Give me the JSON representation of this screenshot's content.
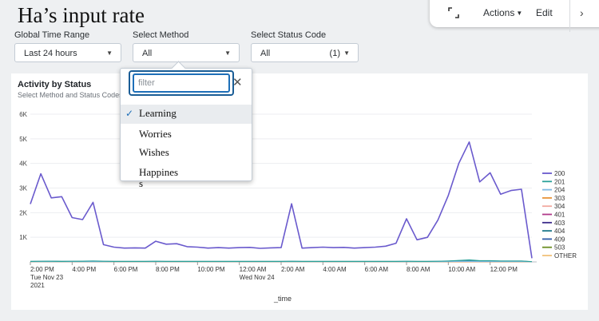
{
  "page": {
    "title": "Ha’s input rate"
  },
  "toolbar": {
    "actions_label": "Actions",
    "edit_label": "Edit"
  },
  "filters": {
    "time_range": {
      "label": "Global Time Range",
      "value": "Last 24 hours"
    },
    "method": {
      "label": "Select Method",
      "value": "All"
    },
    "status_code": {
      "label": "Select Status Code",
      "value": "All",
      "count": "(1)"
    }
  },
  "method_popover": {
    "filter_placeholder": "filter",
    "options": [
      {
        "label": "Learning",
        "selected": true
      },
      {
        "label": "Worries",
        "selected": false
      },
      {
        "label": "Wishes",
        "selected": false
      },
      {
        "label": "Happines\ns",
        "selected": false
      }
    ]
  },
  "panel": {
    "title": "Activity by Status",
    "subtitle": "Select Method and Status Codes"
  },
  "chart_data": {
    "type": "line",
    "xlabel": "_time",
    "ylabel": "",
    "ylim": [
      0,
      6000
    ],
    "y_ticks": [
      "1K",
      "2K",
      "3K",
      "4K",
      "5K",
      "6K"
    ],
    "x_tick_labels": [
      [
        "2:00 PM",
        "Tue Nov 23",
        "2021"
      ],
      [
        "4:00 PM"
      ],
      [
        "6:00 PM"
      ],
      [
        "8:00 PM"
      ],
      [
        "10:00 PM"
      ],
      [
        "12:00 AM",
        "Wed Nov 24"
      ],
      [
        "2:00 AM"
      ],
      [
        "4:00 AM"
      ],
      [
        "6:00 AM"
      ],
      [
        "8:00 AM"
      ],
      [
        "10:00 AM"
      ],
      [
        "12:00 PM"
      ]
    ],
    "grid": true,
    "legend_position": "right",
    "series": [
      {
        "name": "200",
        "color": "#6a5acd",
        "values": [
          2350,
          3580,
          2600,
          2650,
          1800,
          1720,
          2420,
          700,
          600,
          560,
          570,
          560,
          840,
          720,
          740,
          620,
          600,
          560,
          580,
          560,
          580,
          590,
          550,
          570,
          580,
          2360,
          560,
          580,
          600,
          580,
          590,
          560,
          580,
          600,
          640,
          760,
          1750,
          900,
          1000,
          1700,
          2700,
          4000,
          4870,
          3250,
          3620,
          2750,
          2900,
          2950,
          150
        ]
      },
      {
        "name": "201",
        "color": "#2aa198",
        "values": [
          20,
          25,
          30,
          20,
          25,
          30,
          40,
          25,
          20,
          20,
          20,
          20,
          25,
          20,
          20,
          20,
          20,
          20,
          20,
          20,
          20,
          20,
          20,
          20,
          20,
          25,
          20,
          20,
          20,
          20,
          20,
          20,
          20,
          20,
          20,
          20,
          25,
          20,
          20,
          25,
          40,
          60,
          80,
          50,
          50,
          40,
          40,
          40,
          10
        ]
      },
      {
        "name": "204",
        "color": "#7fb8e3",
        "values": [
          10,
          10,
          10,
          10,
          10,
          10,
          10,
          10,
          10,
          10,
          10,
          10,
          10,
          10,
          10,
          10,
          10,
          10,
          10,
          10,
          10,
          10,
          10,
          10,
          10,
          10,
          10,
          10,
          10,
          10,
          10,
          10,
          10,
          10,
          10,
          10,
          10,
          10,
          10,
          10,
          15,
          20,
          20,
          15,
          15,
          15,
          15,
          15,
          5
        ]
      },
      {
        "name": "303",
        "color": "#e8943a",
        "values": [
          5,
          5,
          5,
          5,
          5,
          5,
          5,
          5,
          5,
          5,
          5,
          5,
          5,
          5,
          5,
          5,
          5,
          5,
          5,
          5,
          5,
          5,
          5,
          5,
          5,
          5,
          5,
          5,
          5,
          5,
          5,
          5,
          5,
          5,
          5,
          5,
          5,
          5,
          5,
          5,
          5,
          5,
          5,
          5,
          5,
          5,
          5,
          5,
          5
        ]
      },
      {
        "name": "304",
        "color": "#f2a9a0",
        "values": [
          5,
          5,
          5,
          5,
          5,
          5,
          5,
          5,
          5,
          5,
          5,
          5,
          5,
          5,
          5,
          5,
          5,
          5,
          5,
          5,
          5,
          5,
          5,
          5,
          5,
          5,
          5,
          5,
          5,
          5,
          5,
          5,
          5,
          5,
          5,
          5,
          5,
          5,
          5,
          5,
          5,
          5,
          5,
          5,
          5,
          5,
          5,
          5,
          5
        ]
      },
      {
        "name": "401",
        "color": "#b03a8a",
        "values": [
          5,
          5,
          5,
          5,
          5,
          5,
          5,
          5,
          5,
          5,
          5,
          5,
          5,
          5,
          5,
          5,
          5,
          5,
          5,
          5,
          5,
          5,
          5,
          5,
          5,
          5,
          5,
          5,
          5,
          5,
          5,
          5,
          5,
          5,
          5,
          5,
          5,
          5,
          5,
          5,
          5,
          5,
          5,
          5,
          5,
          5,
          5,
          5,
          5
        ]
      },
      {
        "name": "403",
        "color": "#3b2a8a",
        "values": [
          5,
          5,
          5,
          5,
          5,
          5,
          5,
          5,
          5,
          5,
          5,
          5,
          5,
          5,
          5,
          5,
          5,
          5,
          5,
          5,
          5,
          5,
          5,
          5,
          5,
          5,
          5,
          5,
          5,
          5,
          5,
          5,
          5,
          5,
          5,
          5,
          5,
          5,
          5,
          5,
          5,
          5,
          5,
          5,
          5,
          5,
          5,
          5,
          5
        ]
      },
      {
        "name": "404",
        "color": "#1f7a8c",
        "values": [
          15,
          20,
          30,
          20,
          20,
          20,
          30,
          20,
          15,
          15,
          15,
          15,
          20,
          15,
          15,
          15,
          15,
          15,
          15,
          15,
          15,
          15,
          15,
          15,
          15,
          20,
          15,
          15,
          15,
          15,
          15,
          15,
          15,
          15,
          15,
          15,
          20,
          15,
          15,
          20,
          30,
          50,
          60,
          40,
          40,
          30,
          30,
          30,
          5
        ]
      },
      {
        "name": "409",
        "color": "#2f5aa8",
        "values": [
          5,
          5,
          5,
          5,
          5,
          5,
          5,
          5,
          5,
          5,
          5,
          5,
          5,
          5,
          5,
          5,
          5,
          5,
          5,
          5,
          5,
          5,
          5,
          5,
          5,
          5,
          5,
          5,
          5,
          5,
          5,
          5,
          5,
          5,
          5,
          5,
          5,
          5,
          5,
          5,
          5,
          5,
          5,
          5,
          5,
          5,
          5,
          5,
          5
        ]
      },
      {
        "name": "503",
        "color": "#6b8e23",
        "values": [
          5,
          5,
          5,
          5,
          5,
          5,
          5,
          5,
          5,
          5,
          5,
          5,
          5,
          5,
          5,
          5,
          5,
          5,
          5,
          5,
          5,
          5,
          5,
          5,
          5,
          5,
          5,
          5,
          5,
          5,
          5,
          5,
          5,
          5,
          5,
          5,
          5,
          5,
          5,
          5,
          5,
          5,
          5,
          5,
          5,
          5,
          5,
          5,
          5
        ]
      },
      {
        "name": "OTHER",
        "color": "#f0c27a",
        "values": [
          5,
          5,
          5,
          5,
          5,
          5,
          5,
          5,
          5,
          5,
          5,
          5,
          5,
          5,
          5,
          5,
          5,
          5,
          5,
          5,
          5,
          5,
          5,
          5,
          5,
          5,
          5,
          5,
          5,
          5,
          5,
          5,
          5,
          5,
          5,
          5,
          5,
          5,
          5,
          5,
          5,
          5,
          5,
          5,
          5,
          5,
          5,
          5,
          5
        ]
      }
    ]
  }
}
